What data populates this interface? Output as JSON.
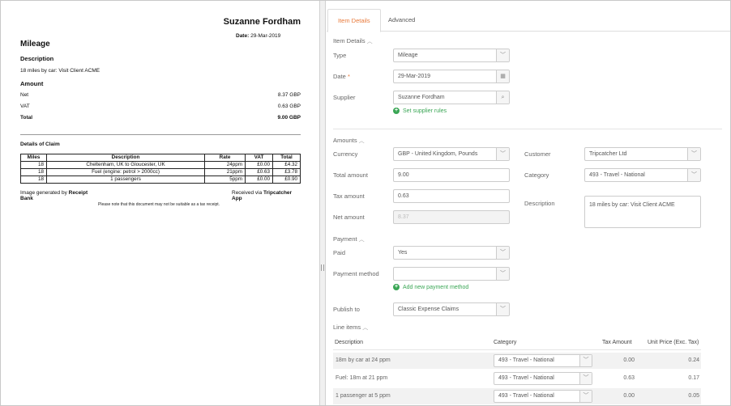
{
  "receipt": {
    "name": "Suzanne Fordham",
    "date_label": "Date:",
    "date_value": "29-Mar-2019",
    "title": "Mileage",
    "description_heading": "Description",
    "description": "18 miles by car: Visit Client ACME",
    "amount_heading": "Amount",
    "amounts": [
      {
        "label": "Net",
        "value": "8.37 GBP"
      },
      {
        "label": "VAT",
        "value": "0.63 GBP"
      },
      {
        "label": "Total",
        "value": "9.00 GBP"
      }
    ],
    "claim_heading": "Details of Claim",
    "table_headers": [
      "Miles",
      "Description",
      "Rate",
      "VAT",
      "Total"
    ],
    "table_rows": [
      [
        "18",
        "Cheltenham, UK to Gloucester, UK",
        "24ppm",
        "£0.00",
        "£4.32"
      ],
      [
        "18",
        "Fuel (engine: petrol > 2000cc)",
        "21ppm",
        "£0.63",
        "£3.78"
      ],
      [
        "18",
        "1 passengers",
        "5ppm",
        "£0.00",
        "£0.90"
      ]
    ],
    "generated_prefix": "Image generated by",
    "generated_by": "Receipt Bank",
    "received_prefix": "Received via",
    "received_via": "Tripcatcher App",
    "note": "Please note that this document may not be suitable as a tax receipt."
  },
  "tabs": [
    "Item Details",
    "Advanced"
  ],
  "item_details": {
    "title": "Item Details",
    "type_label": "Type",
    "type_value": "Mileage",
    "date_label": "Date",
    "date_required": "*",
    "date_value": "29-Mar-2019",
    "supplier_label": "Supplier",
    "supplier_value": "Suzanne Fordham",
    "supplier_rules_link": "Set supplier rules"
  },
  "amounts": {
    "title": "Amounts",
    "currency_label": "Currency",
    "currency_value": "GBP - United Kingdom, Pounds",
    "total_label": "Total amount",
    "total_value": "9.00",
    "tax_label": "Tax amount",
    "tax_value": "0.63",
    "net_label": "Net amount",
    "net_value": "8.37",
    "customer_label": "Customer",
    "customer_value": "Tripcatcher Ltd",
    "category_label": "Category",
    "category_value": "493 - Travel - National",
    "description_label": "Description",
    "description_value": "18 miles by car: Visit Client ACME"
  },
  "payment": {
    "title": "Payment",
    "paid_label": "Paid",
    "paid_value": "Yes",
    "method_label": "Payment method",
    "method_value": "",
    "add_method_link": "Add new payment method",
    "publish_label": "Publish to",
    "publish_value": "Classic Expense Claims"
  },
  "line_items": {
    "title": "Line items",
    "headers": {
      "description": "Description",
      "category": "Category",
      "tax": "Tax Amount",
      "price": "Unit Price (Exc. Tax)"
    },
    "rows": [
      {
        "description": "18m by car at 24 ppm",
        "category": "493 - Travel - National",
        "tax": "0.00",
        "price": "0.24"
      },
      {
        "description": "Fuel: 18m at 21 ppm",
        "category": "493 - Travel - National",
        "tax": "0.63",
        "price": "0.17"
      },
      {
        "description": "1 passenger at 5 ppm",
        "category": "493 - Travel - National",
        "tax": "0.00",
        "price": "0.05"
      }
    ]
  },
  "colors": {
    "accent": "#e8793a",
    "link": "#3aa655"
  }
}
